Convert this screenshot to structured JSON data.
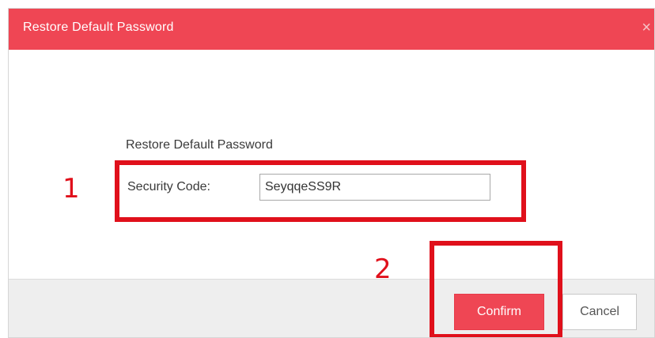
{
  "dialog": {
    "title": "Restore Default Password",
    "close_icon": "close-icon",
    "close_glyph": "×"
  },
  "form": {
    "section_heading": "Restore Default Password",
    "security_code_label": "Security Code:",
    "security_code_value": "SeyqqeSS9R"
  },
  "annotations": {
    "step_1": "1",
    "step_2": "2"
  },
  "footer": {
    "confirm_label": "Confirm",
    "cancel_label": "Cancel"
  },
  "colors": {
    "accent": "#ef4654",
    "annotation": "#e0101b",
    "footer_bg": "#eeeeee"
  }
}
